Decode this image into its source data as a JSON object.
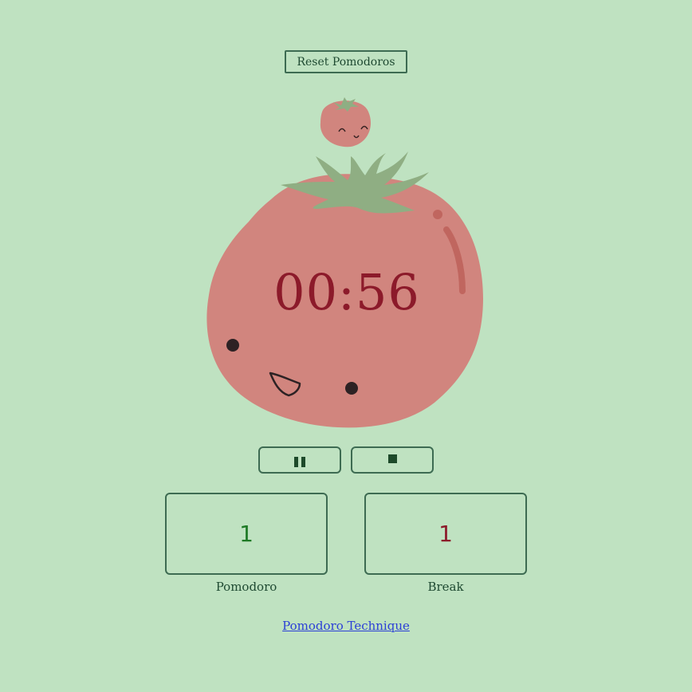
{
  "header": {
    "reset_label": "Reset Pomodoros"
  },
  "timer": {
    "display": "00:56"
  },
  "controls": {
    "pause_icon": "pause-icon",
    "stop_icon": "stop-icon"
  },
  "counters": [
    {
      "value": "1",
      "label": "Pomodoro"
    },
    {
      "value": "1",
      "label": "Break"
    }
  ],
  "footer": {
    "link_text": "Pomodoro Technique"
  },
  "colors": {
    "background": "#bfe2c1",
    "tomato": "#d1857e",
    "leaves": "#8fae83",
    "timer_text": "#8c1a2a",
    "pomodoro_count": "#1e7a26",
    "break_count": "#8c1a2a",
    "link": "#2b3fd6"
  }
}
